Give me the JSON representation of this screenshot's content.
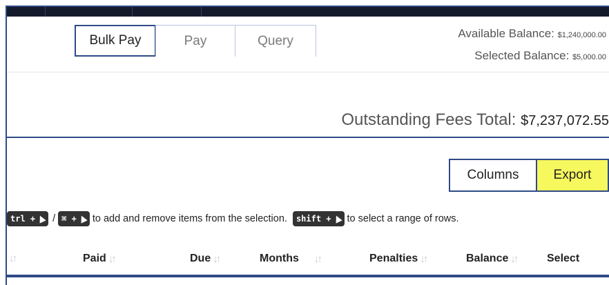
{
  "tabs": [
    {
      "label": "Bulk Pay",
      "active": true
    },
    {
      "label": "Pay",
      "active": false
    },
    {
      "label": "Query",
      "active": false
    }
  ],
  "balances": {
    "available_label": "Available Balance:",
    "available_amount": "$1,240,000.00",
    "selected_label": "Selected Balance:",
    "selected_amount": "$5,000.00"
  },
  "outstanding": {
    "label": "Outstanding Fees Total:",
    "total": "$7,237,072.55"
  },
  "buttons": {
    "columns": "Columns",
    "export": "Export"
  },
  "hint": {
    "ctrl_key": "trl +",
    "slash": "/",
    "cmd_key": "⌘ +",
    "add_remove_text": "to add and remove items from the selection.",
    "shift_key": "shift +",
    "range_text": "to select a range of rows."
  },
  "table": {
    "columns": [
      "Paid",
      "Due",
      "Months",
      "Penalties",
      "Balance",
      "Select"
    ]
  },
  "colors": {
    "accent": "#2e4a87",
    "export_bg": "#f7f75e",
    "topbar": "#141a2a"
  }
}
